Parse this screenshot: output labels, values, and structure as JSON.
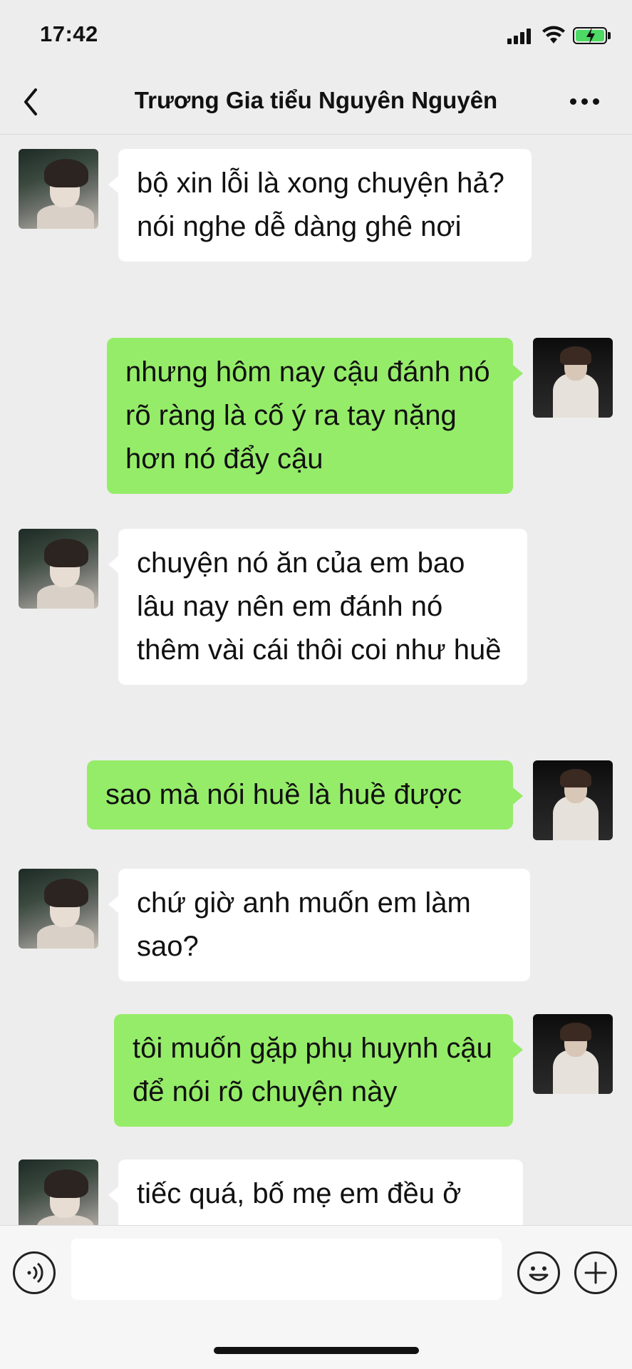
{
  "status_bar": {
    "time": "17:42"
  },
  "header": {
    "title": "Trương Gia tiểu Nguyên Nguyên"
  },
  "messages": [
    {
      "side": "left",
      "text": "bộ xin lỗi là xong chuyện hả? nói nghe dễ dàng ghê nơi"
    },
    {
      "side": "right",
      "text": "nhưng hôm nay cậu đánh nó rõ ràng là cố ý ra tay nặng hơn nó đẩy cậu"
    },
    {
      "side": "left",
      "text": "chuyện nó ăn của em bao lâu nay nên em đánh nó thêm vài cái thôi coi như huề"
    },
    {
      "side": "right",
      "text": "sao mà nói huề là huề được"
    },
    {
      "side": "left",
      "text": "chứ giờ anh muốn em làm sao?"
    },
    {
      "side": "right",
      "text": "tôi muốn gặp phụ huynh cậu để nói rõ chuyện này"
    },
    {
      "side": "left",
      "text": "tiếc quá, bố mẹ em đều ở"
    }
  ],
  "input_bar": {
    "value": ""
  },
  "colors": {
    "sent_bubble": "#95ec69",
    "received_bubble": "#ffffff",
    "background": "#ededed"
  },
  "icons": {
    "back": "chevron-left-icon",
    "more": "more-icon",
    "voice": "voice-icon",
    "emoji": "emoji-icon",
    "plus": "plus-icon"
  }
}
